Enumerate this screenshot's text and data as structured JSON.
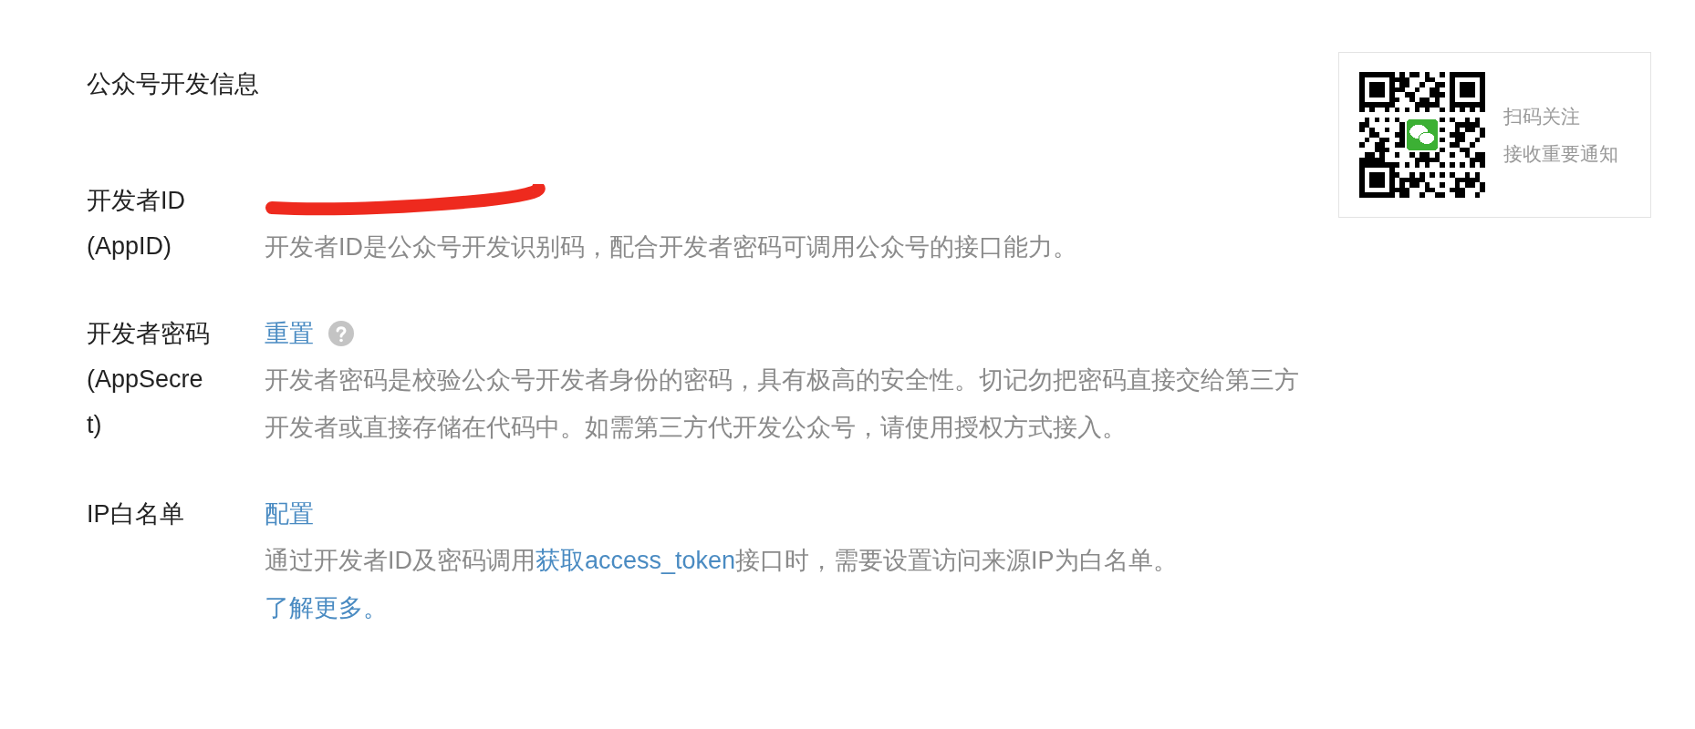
{
  "title": "公众号开发信息",
  "rows": [
    {
      "kind": "redacted",
      "label": "开发者ID",
      "sublabel": "(AppID)",
      "description": [
        {
          "kind": "text",
          "text": "开发者ID是公众号开发识别码，配合开发者密码可调用公众号的接口能力。"
        }
      ]
    },
    {
      "kind": "action",
      "label": "开发者密码",
      "sublabel": "(AppSecret)",
      "action": "重置",
      "help": true,
      "description": [
        {
          "kind": "text",
          "text": "开发者密码是校验公众号开发者身份的密码，具有极高的安全性。切记勿把密码直接交给第三方开发者或直接存储在代码中。如需第三方代开发公众号，请使用授权方式接入。"
        }
      ]
    },
    {
      "kind": "action",
      "label": "IP白名单",
      "action": "配置",
      "help": false,
      "description": [
        {
          "kind": "text",
          "text": "通过开发者ID及密码调用"
        },
        {
          "kind": "link",
          "text": "获取access_token"
        },
        {
          "kind": "text",
          "text": "接口时，需要设置访问来源IP为白名单。"
        },
        {
          "kind": "link",
          "text": "了解更多。"
        }
      ]
    }
  ],
  "qr_card": {
    "lines": [
      "扫码关注",
      "接收重要通知"
    ]
  }
}
